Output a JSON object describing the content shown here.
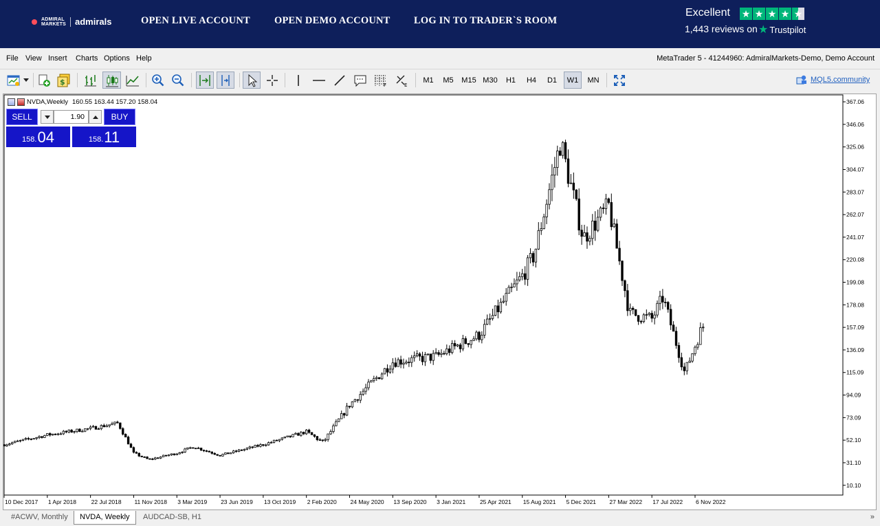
{
  "banner": {
    "logo_small": "ADMIRAL MARKETS",
    "logo_name": "admirals",
    "nav": [
      "OPEN LIVE ACCOUNT",
      "OPEN DEMO ACCOUNT",
      "LOG IN TO TRADER`S ROOM"
    ],
    "trustpilot_rating": "Excellent",
    "trustpilot_reviews": "1,443 reviews on",
    "trustpilot_brand": "Trustpilot",
    "brand_color": "#0e1f5b",
    "accent_color": "#00b67a"
  },
  "menu": {
    "items": [
      "File",
      "View",
      "Insert",
      "Charts",
      "Options",
      "Help"
    ],
    "window_title": "MetaTrader 5 - 41244960: AdmiralMarkets-Demo, Demo Account"
  },
  "toolbar": {
    "timeframes": [
      "M1",
      "M5",
      "M15",
      "M30",
      "H1",
      "H4",
      "D1",
      "W1",
      "MN"
    ],
    "selected_timeframe": "W1",
    "community_link": "MQL5.community",
    "icons": [
      "new-chart-icon",
      "dropdown-arrow-icon",
      "new-order-icon",
      "algo-trading-icon",
      "bar-chart-icon",
      "candlestick-icon",
      "line-chart-icon",
      "zoom-in-icon",
      "zoom-out-icon",
      "auto-scroll-icon",
      "chart-shift-icon",
      "cursor-icon",
      "crosshair-icon",
      "vertical-line-icon",
      "horizontal-line-icon",
      "trendline-icon",
      "text-label-icon",
      "fibonacci-icon",
      "objects-icon",
      "fullscreen-icon",
      "community-icon"
    ]
  },
  "chart": {
    "symbol_header": "NVDA,Weekly",
    "ohlc": "160.55 163.44 157.20 158.04"
  },
  "trade_panel": {
    "sell_label": "SELL",
    "buy_label": "BUY",
    "volume": "1.90",
    "bid_prefix": "158.",
    "bid_big": "04",
    "ask_prefix": "158.",
    "ask_big": "11"
  },
  "chart_data": {
    "type": "candlestick",
    "symbol": "NVDA",
    "timeframe": "Weekly",
    "y_ticks": [
      "367.06",
      "346.06",
      "325.06",
      "304.07",
      "283.07",
      "262.07",
      "241.07",
      "220.08",
      "199.08",
      "178.08",
      "157.09",
      "136.09",
      "115.09",
      "94.09",
      "73.09",
      "52.10",
      "31.10",
      "10.10"
    ],
    "x_ticks": [
      "10 Dec 2017",
      "1 Apr 2018",
      "22 Jul 2018",
      "11 Nov 2018",
      "3 Mar 2019",
      "23 Jun 2019",
      "13 Oct 2019",
      "2 Feb 2020",
      "24 May 2020",
      "13 Sep 2020",
      "3 Jan 2021",
      "25 Apr 2021",
      "15 Aug 2021",
      "5 Dec 2021",
      "27 Mar 2022",
      "17 Jul 2022",
      "6 Nov 2022"
    ],
    "ylim": [
      0,
      374
    ],
    "grid": false,
    "approx_weekly_closes": {
      "2017-12-10": 48,
      "2018-04-01": 57,
      "2018-07-22": 63,
      "2018-10-01": 68,
      "2018-11-11": 40,
      "2018-12-20": 34,
      "2019-03-03": 40,
      "2019-04-15": 46,
      "2019-06-23": 38,
      "2019-10-13": 48,
      "2020-02-02": 60,
      "2020-03-16": 50,
      "2020-05-24": 85,
      "2020-09-13": 125,
      "2021-01-03": 130,
      "2021-04-25": 150,
      "2021-08-15": 205,
      "2021-09-15": 225,
      "2021-11-22": 330,
      "2021-12-05": 310,
      "2022-01-20": 240,
      "2022-03-27": 270,
      "2022-05-20": 170,
      "2022-07-17": 165,
      "2022-08-15": 185,
      "2022-10-10": 115,
      "2022-11-06": 140,
      "2022-11-25": 158
    }
  },
  "tabs": [
    "#ACWV, Monthly",
    "NVDA, Weekly",
    "AUDCAD-SB, H1"
  ],
  "active_tab": "NVDA, Weekly",
  "tabs_more": "»"
}
